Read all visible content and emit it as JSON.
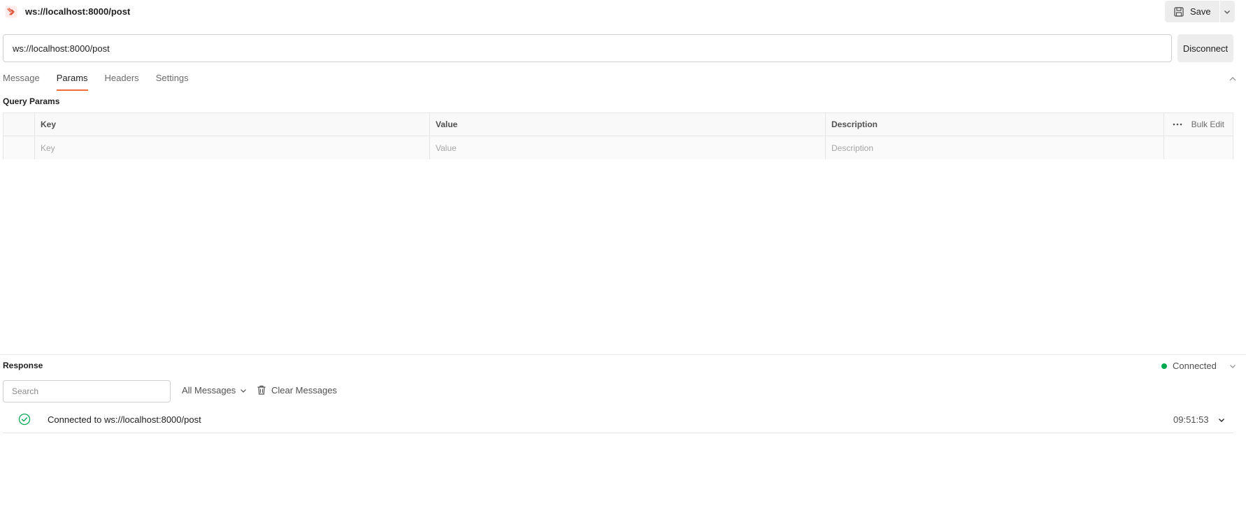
{
  "request": {
    "title": "ws://localhost:8000/post",
    "url": "ws://localhost:8000/post",
    "save_label": "Save",
    "disconnect_label": "Disconnect"
  },
  "tabs": [
    {
      "label": "Message",
      "active": false
    },
    {
      "label": "Params",
      "active": true
    },
    {
      "label": "Headers",
      "active": false
    },
    {
      "label": "Settings",
      "active": false
    }
  ],
  "params": {
    "section_title": "Query Params",
    "columns": {
      "key": "Key",
      "value": "Value",
      "description": "Description"
    },
    "bulk_edit_label": "Bulk Edit",
    "placeholders": {
      "key": "Key",
      "value": "Value",
      "description": "Description"
    }
  },
  "response": {
    "title": "Response",
    "status": "Connected",
    "status_color": "#00a94f",
    "search_placeholder": "Search",
    "filter_label": "All Messages",
    "clear_label": "Clear Messages",
    "messages": [
      {
        "text": "Connected to ws://localhost:8000/post",
        "time": "09:51:53",
        "icon": "check-circle-icon"
      }
    ]
  },
  "colors": {
    "accent": "#f26b3a",
    "brand_icon": "#e04a2f"
  }
}
